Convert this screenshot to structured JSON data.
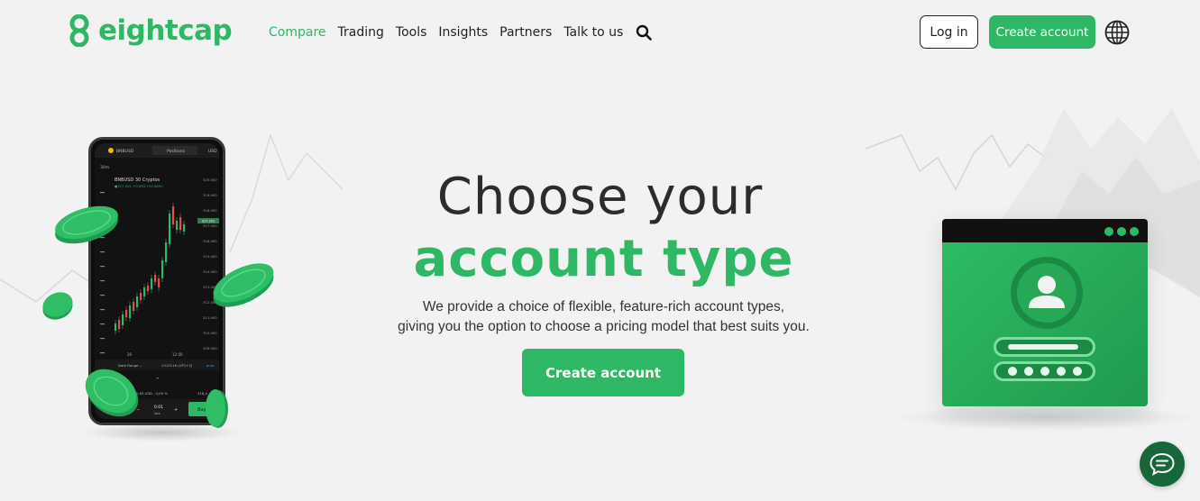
{
  "brand": {
    "logo_text": "eightcap",
    "accent": "#2eb866"
  },
  "nav": {
    "items": [
      {
        "label": "Compare",
        "active": true
      },
      {
        "label": "Trading",
        "active": false
      },
      {
        "label": "Tools",
        "active": false
      },
      {
        "label": "Insights",
        "active": false
      },
      {
        "label": "Partners",
        "active": false
      },
      {
        "label": "Talk to us",
        "active": false
      }
    ],
    "search_icon": "search-icon"
  },
  "header": {
    "login_label": "Log in",
    "create_label": "Create account",
    "globe_icon": "globe-icon"
  },
  "hero": {
    "title_line1": "Choose your",
    "title_line2": "account type",
    "subtitle_line1": "We provide a choice of flexible, feature-rich account types,",
    "subtitle_line2": "giving you the option to choose a pricing model that best suits you.",
    "cta_label": "Create account"
  },
  "phone": {
    "symbol": "BNBUSD",
    "tab_positions": "Positions",
    "currency": "USD",
    "timeframe": "30m",
    "chart_title": "BNBUSD  30  Cryptos",
    "price_line": "●317.201 +0.653 (+0.56%)",
    "price_tag": "317.201",
    "price_ticks": [
      "320.000",
      "319.000",
      "318.000",
      "317.000",
      "316.000",
      "315.000",
      "314.000",
      "313.000",
      "312.000",
      "311.000",
      "310.000",
      "309.000"
    ],
    "time_labels": [
      "29",
      "12:00"
    ],
    "date_range": "Date Range ⌄",
    "clock": "13:23:16 (UTC+2)",
    "auto": "auto",
    "pnl": "0,63 USD - 0,09 %",
    "right_value": "318,4",
    "lots_value": "0.01",
    "lots_label": "lots",
    "buy_label": "Buy"
  },
  "chat": {
    "icon": "chat-icon"
  }
}
